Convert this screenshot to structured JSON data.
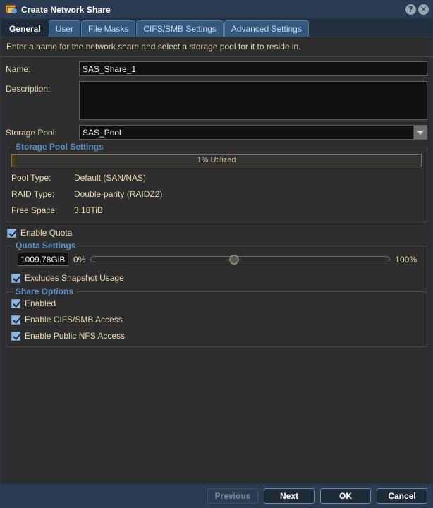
{
  "window": {
    "title": "Create Network Share",
    "icon": "network-share-folder-icon",
    "help_label": "?",
    "close_label": "✕"
  },
  "tabs": [
    {
      "label": "General",
      "active": true
    },
    {
      "label": "User",
      "active": false
    },
    {
      "label": "File Masks",
      "active": false
    },
    {
      "label": "CIFS/SMB Settings",
      "active": false
    },
    {
      "label": "Advanced Settings",
      "active": false
    }
  ],
  "instruction": "Enter a name for the network share and select a storage pool for it to reside in.",
  "fields": {
    "name_label": "Name:",
    "name_value": "SAS_Share_1",
    "name_placeholder": "",
    "description_label": "Description:",
    "description_value": "",
    "description_placeholder": "",
    "storage_pool_label": "Storage Pool:",
    "storage_pool_value": "SAS_Pool",
    "storage_pool_options": [
      "SAS_Pool"
    ]
  },
  "storage_pool_settings": {
    "legend": "Storage Pool Settings",
    "utilization_text": "1% Utilized",
    "utilization_percent": 1,
    "rows": [
      {
        "key": "Pool Type:",
        "value": "Default (SAN/NAS)"
      },
      {
        "key": "RAID Type:",
        "value": "Double-parity (RAIDZ2)"
      },
      {
        "key": "Free Space:",
        "value": "3.18TiB"
      }
    ]
  },
  "quota": {
    "enable_label": "Enable Quota",
    "enable_checked": true,
    "legend": "Quota Settings",
    "value": "1009.78GiB",
    "min_label": "0%",
    "max_label": "100%",
    "slider_percent": 48,
    "exclude_snapshot_label": "Excludes Snapshot Usage",
    "exclude_snapshot_checked": true
  },
  "share_options": {
    "legend": "Share Options",
    "items": [
      {
        "label": "Enabled",
        "checked": true
      },
      {
        "label": "Enable CIFS/SMB Access",
        "checked": true
      },
      {
        "label": "Enable Public NFS Access",
        "checked": true
      }
    ]
  },
  "footer": {
    "previous": "Previous",
    "previous_disabled": true,
    "next": "Next",
    "ok": "OK",
    "cancel": "Cancel"
  },
  "colors": {
    "titlebar": "#2b3c52",
    "accent_legend": "#5b93c9",
    "label_text": "#e8d9b0",
    "body_bg": "#2e2e2e",
    "tab_inactive": "#33597f",
    "checkbox": "#8fb6de",
    "progress_fill": "#4a3c12"
  }
}
